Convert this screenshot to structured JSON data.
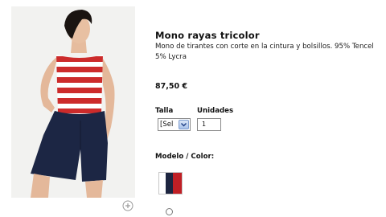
{
  "product": {
    "title": "Mono rayas tricolor",
    "description": "Mono de tirantes con corte en la cintura y bolsillos. 95% Tencel 5% Lycra",
    "price": "87,50 €",
    "image_alt": "Modelo con mono de rayas tricolor"
  },
  "options": {
    "size_label": "Talla",
    "size_selected": "[Sel",
    "units_label": "Unidades",
    "units_value": "1",
    "model_color_label": "Modelo / Color:"
  },
  "icons": {
    "zoom": "zoom-plus-icon",
    "select_arrow": "chevron-down-icon"
  },
  "colors": {
    "stripe_red": "#cc2b2b",
    "navy": "#1c2644",
    "swatch_red": "#c01f25",
    "swatch_navy": "#1d2540",
    "select_accent": "#a9c2ea"
  }
}
